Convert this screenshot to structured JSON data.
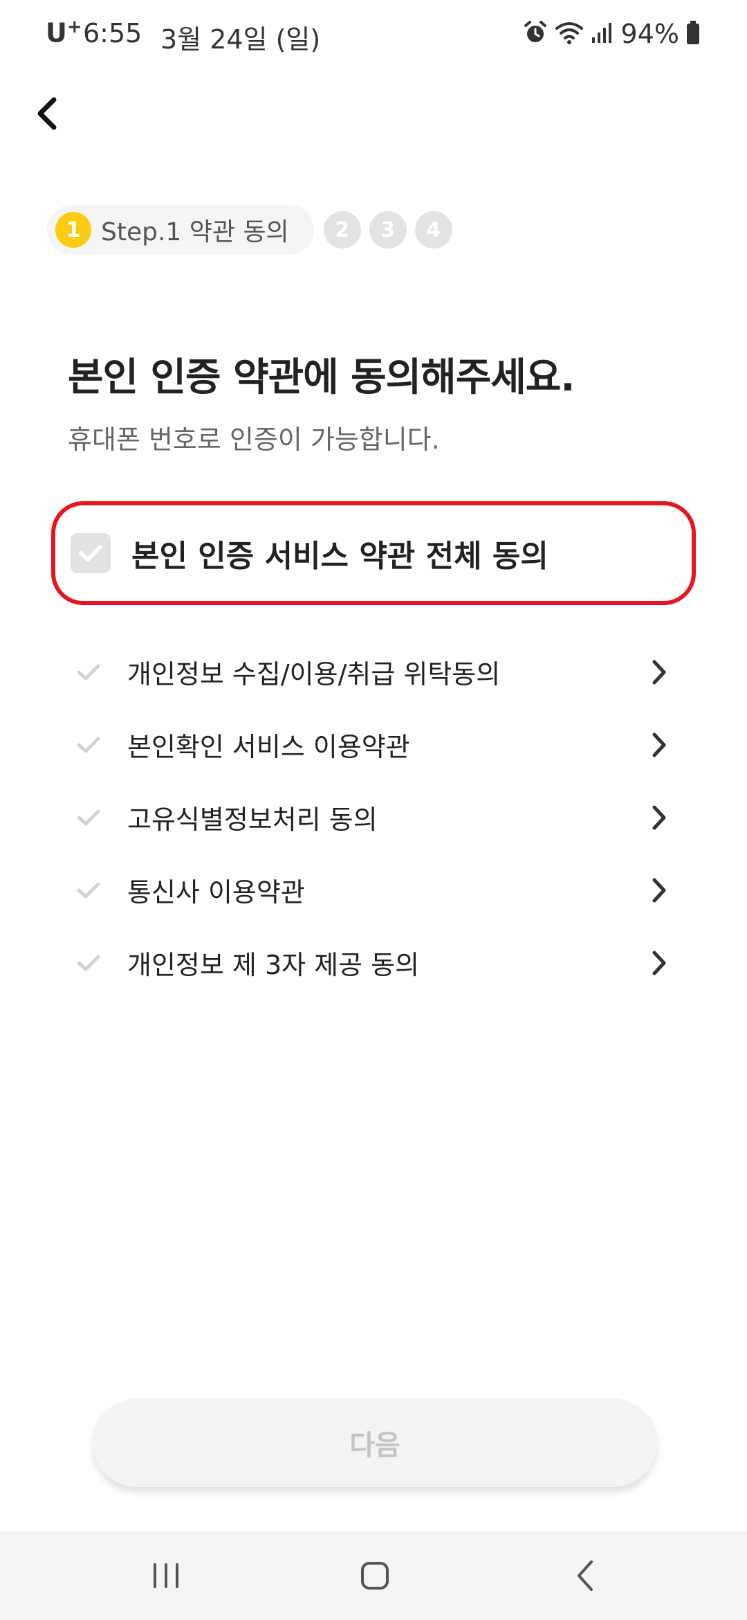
{
  "status_bar": {
    "carrier": "U",
    "carrier_plus": "+",
    "time": "6:55",
    "date": "3월 24일 (일)",
    "battery": "94%",
    "icons": [
      "alarm-icon",
      "wifi-icon",
      "signal-icon",
      "battery-icon"
    ]
  },
  "header": {
    "back_icon": "chevron-left-icon"
  },
  "stepper": {
    "active": {
      "number": "1",
      "label": "Step.1 약관 동의"
    },
    "steps": [
      "2",
      "3",
      "4"
    ],
    "active_color": "#fccc14"
  },
  "main": {
    "title": "본인 인증 약관에 동의해주세요.",
    "subtitle": "휴대폰 번호로 인증이 가능합니다.",
    "agree_all": {
      "label": "본인 인증 서비스 약관 전체 동의",
      "checked": false,
      "highlight_color": "#e8141e"
    },
    "terms": [
      {
        "label": "개인정보 수집/이용/취급 위탁동의",
        "checked": false
      },
      {
        "label": "본인확인 서비스 이용약관",
        "checked": false
      },
      {
        "label": "고유식별정보처리 동의",
        "checked": false
      },
      {
        "label": "통신사 이용약관",
        "checked": false
      },
      {
        "label": "개인정보 제 3자 제공 동의",
        "checked": false
      }
    ]
  },
  "footer": {
    "next_label": "다음",
    "next_enabled": false
  },
  "nav_bar": {
    "buttons": [
      "recent-apps-icon",
      "home-icon",
      "back-icon"
    ]
  }
}
